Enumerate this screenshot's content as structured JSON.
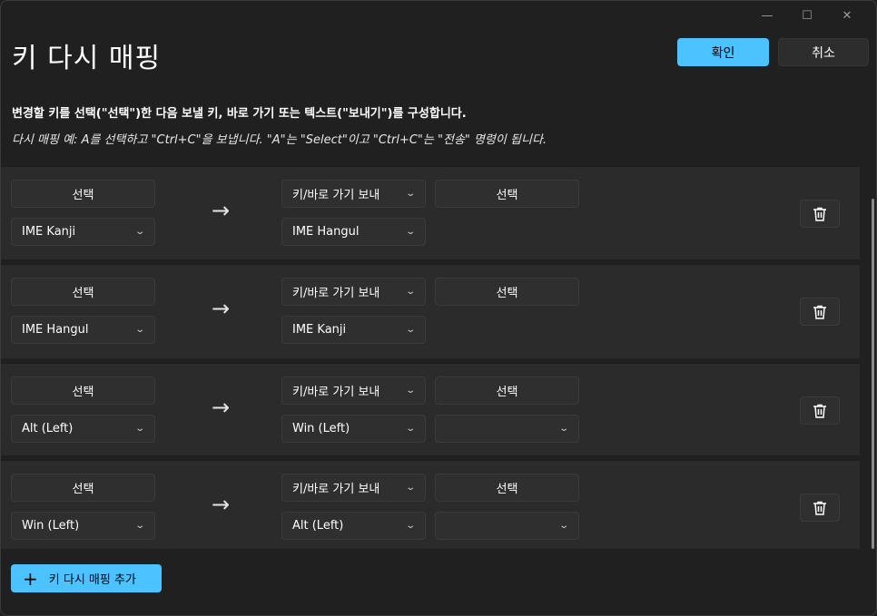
{
  "window": {
    "minimize_glyph": "—",
    "maximize_glyph": "☐",
    "close_glyph": "✕"
  },
  "header": {
    "title": "키 다시 매핑",
    "ok_label": "확인",
    "cancel_label": "취소"
  },
  "instructions": {
    "main": "변경할 키를 선택(\"선택\")한 다음 보낼 키, 바로 가기 또는 텍스트(\"보내기\")를 구성합니다.",
    "example": "다시 매핑 예: A를 선택하고 \"Ctrl+C\"을 보냅니다. \"A\"는 \"Select\"이고 \"Ctrl+C\"는 \"전송\" 명령이 됩니다."
  },
  "rows": [
    {
      "select_label": "선택",
      "source_key": "IME Kanji",
      "arrow": "→",
      "action_type": "키/바로 가기 보내",
      "target_select_label": "선택",
      "target_key": "IME Hangul",
      "target_key2": ""
    },
    {
      "select_label": "선택",
      "source_key": "IME Hangul",
      "arrow": "→",
      "action_type": "키/바로 가기 보내",
      "target_select_label": "선택",
      "target_key": "IME Kanji",
      "target_key2": ""
    },
    {
      "select_label": "선택",
      "source_key": "Alt (Left)",
      "arrow": "→",
      "action_type": "키/바로 가기 보내",
      "target_select_label": "선택",
      "target_key": "Win (Left)",
      "target_key2": ""
    },
    {
      "select_label": "선택",
      "source_key": "Win (Left)",
      "arrow": "→",
      "action_type": "키/바로 가기 보내",
      "target_select_label": "선택",
      "target_key": "Alt (Left)",
      "target_key2": ""
    }
  ],
  "footer": {
    "add_label": "키 다시 매핑 추가",
    "add_icon": "+"
  },
  "colors": {
    "accent": "#4cc2ff",
    "background": "#202020",
    "row_background": "#2b2b2b",
    "control_background": "#2f2f2f"
  },
  "icons": {
    "chevron": "chevron-down-icon",
    "delete": "trash-icon",
    "arrow": "arrow-right-icon",
    "add": "plus-icon"
  }
}
